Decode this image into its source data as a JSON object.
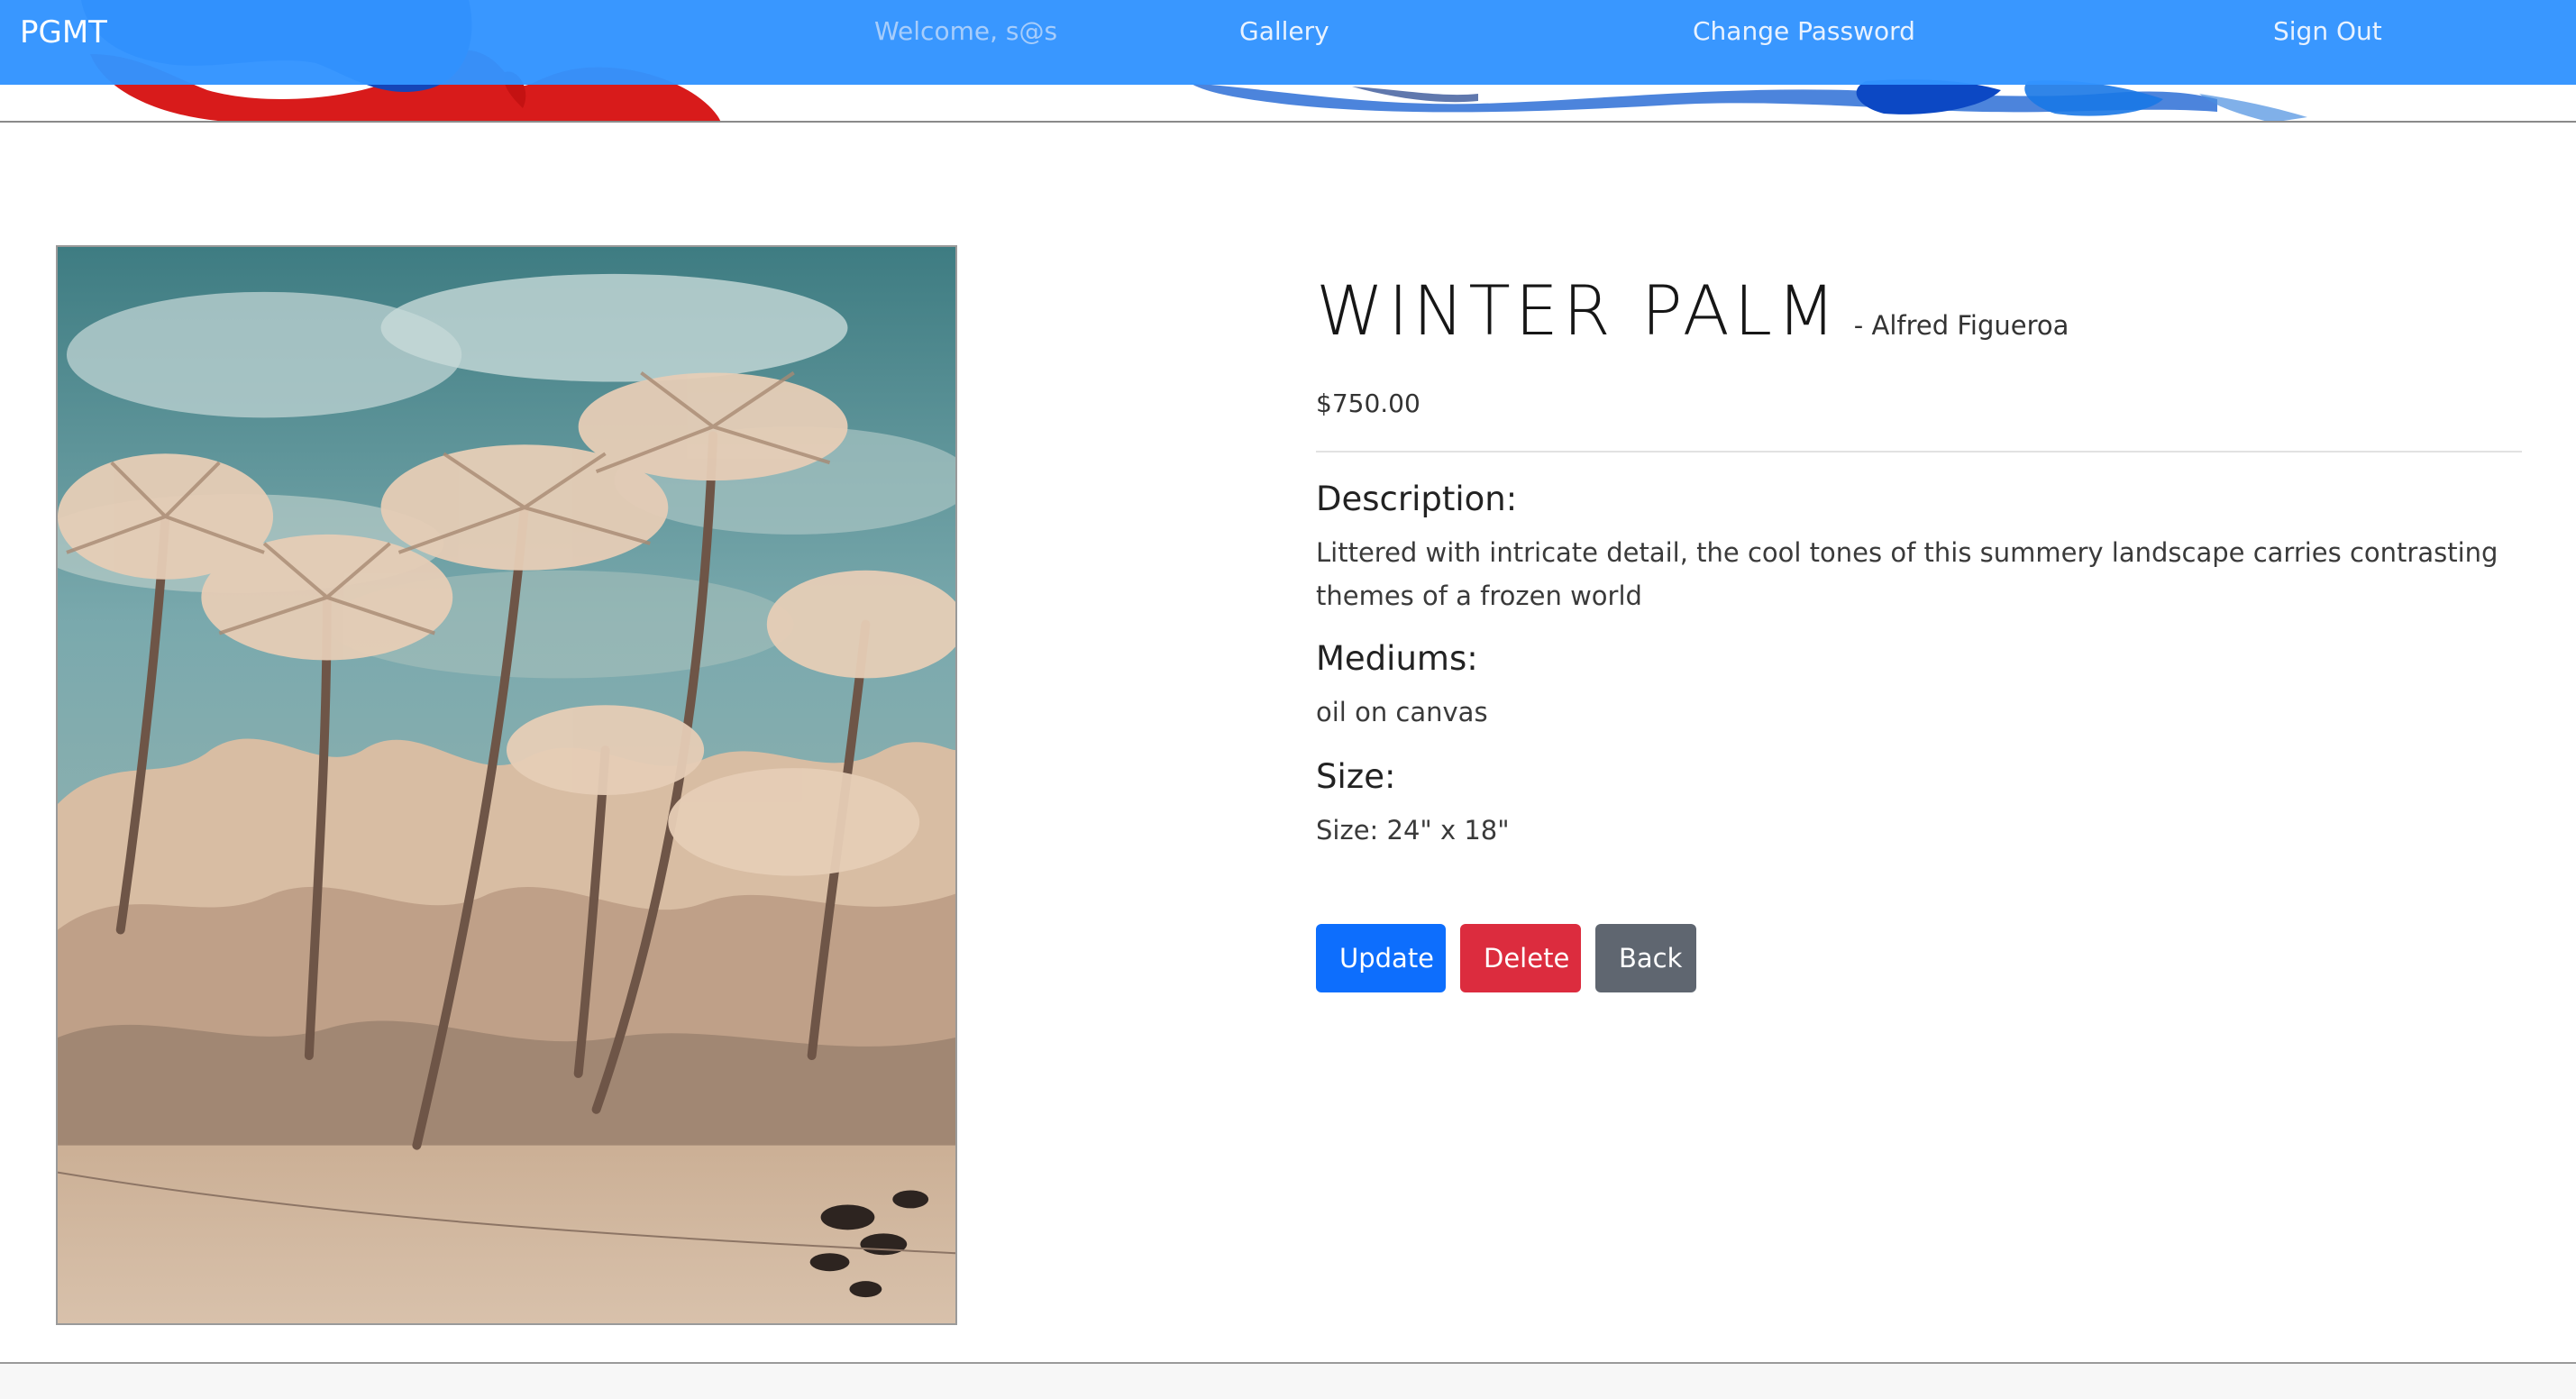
{
  "nav": {
    "brand": "PGMT",
    "welcome": "Welcome, s@s",
    "gallery": "Gallery",
    "change_password": "Change Password",
    "sign_out": "Sign Out"
  },
  "artwork": {
    "title": "WINTER PALM",
    "artist": "- Alfred Figueroa",
    "price": "$750.00",
    "description_heading": "Description:",
    "description": "Littered with intricate detail, the cool tones of this summery landscape carries contrasting themes of a frozen world",
    "mediums_heading": "Mediums:",
    "mediums": "oil on canvas",
    "size_heading": "Size:",
    "size": "Size: 24\" x 18\""
  },
  "actions": {
    "update": "Update",
    "delete": "Delete",
    "back": "Back"
  },
  "colors": {
    "navbar": "#3394ff",
    "update_button": "#0d6efd",
    "delete_button": "#dc2c3e",
    "back_button": "#5f6670"
  }
}
